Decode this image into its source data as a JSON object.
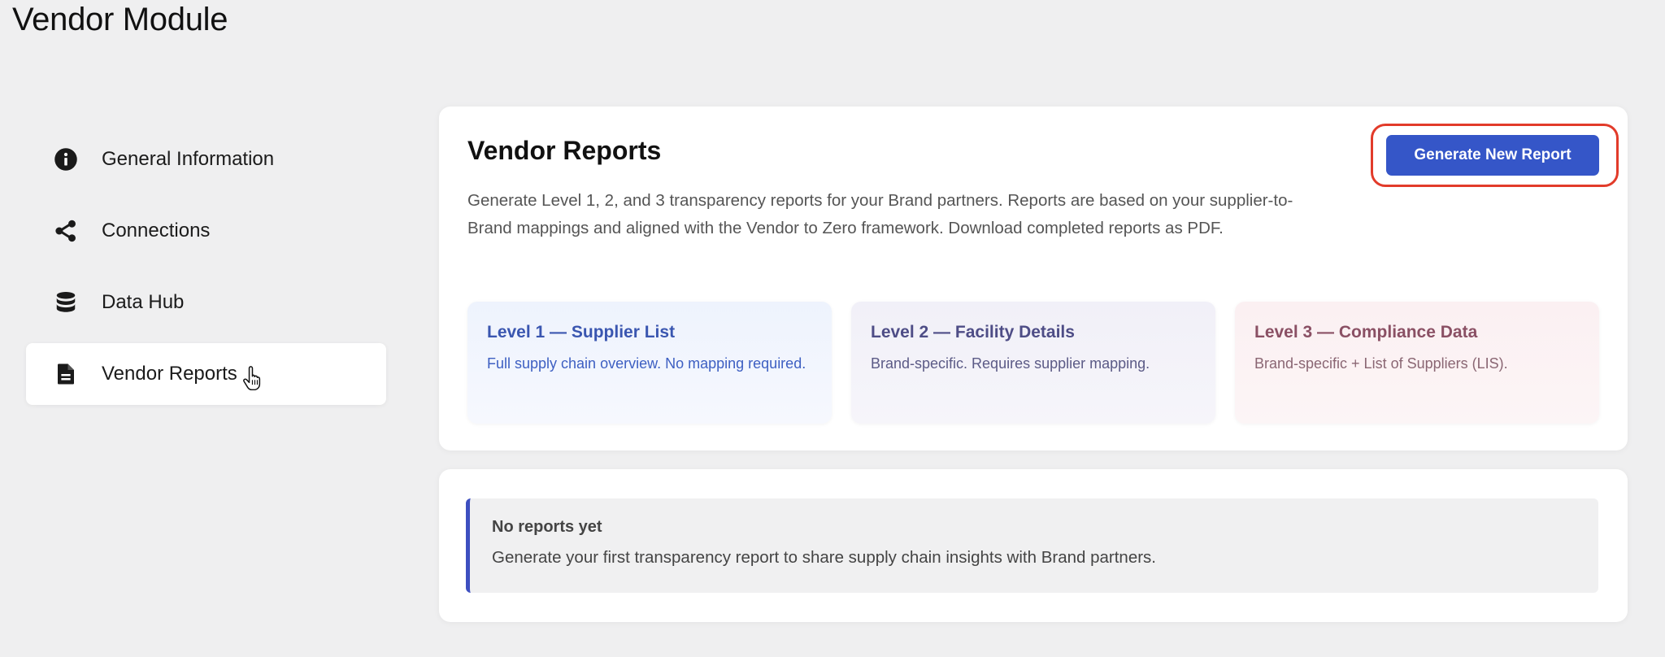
{
  "app": {
    "title": "Vendor Module"
  },
  "sidebar": {
    "items": [
      {
        "label": "General Information",
        "icon": "info-circle-icon"
      },
      {
        "label": "Connections",
        "icon": "share-icon"
      },
      {
        "label": "Data Hub",
        "icon": "database-icon"
      },
      {
        "label": "Vendor Reports",
        "icon": "document-icon",
        "active": true
      }
    ]
  },
  "reports": {
    "title": "Vendor Reports",
    "description": "Generate Level 1, 2, and 3 transparency reports for your Brand partners. Reports are based on your supplier-to-Brand mappings and aligned with the Vendor to Zero framework. Download completed reports as PDF.",
    "generate_button": "Generate New Report",
    "levels": [
      {
        "title": "Level 1 — Supplier List",
        "description": "Full supply chain overview. No mapping required."
      },
      {
        "title": "Level 2 — Facility Details",
        "description": "Brand-specific. Requires supplier mapping."
      },
      {
        "title": "Level 3 — Compliance Data",
        "description": "Brand-specific + List of Suppliers (LIS)."
      }
    ]
  },
  "empty_state": {
    "title": "No reports yet",
    "description": "Generate your first transparency report to share supply chain insights with Brand partners."
  },
  "colors": {
    "accent": "#3556c8",
    "highlight_ring": "#e23b2a",
    "empty_border": "#3d4fc0"
  }
}
